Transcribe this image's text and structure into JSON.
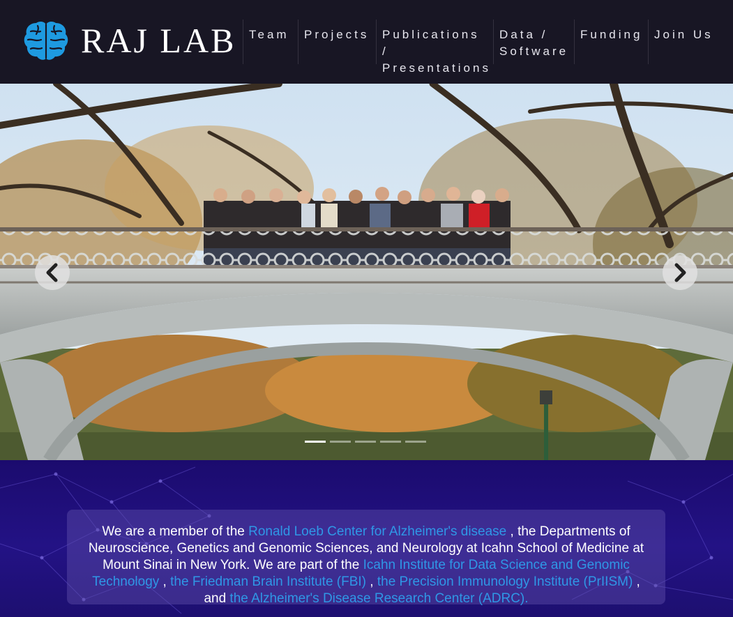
{
  "header": {
    "logo_icon": "brain-icon",
    "logo_text": "RAJ LAB",
    "accent_color": "#1e9ae0"
  },
  "nav": {
    "items": [
      {
        "label": "Team"
      },
      {
        "label": "Projects"
      },
      {
        "label": "Publications /\nPresentations"
      },
      {
        "label": "Data /\nSoftware"
      },
      {
        "label": "Funding"
      },
      {
        "label": "Join Us"
      }
    ]
  },
  "carousel": {
    "prev_icon": "chevron-left-icon",
    "next_icon": "chevron-right-icon",
    "slide_count": 5,
    "active_slide": 1
  },
  "about": {
    "t1": "We are a member of the ",
    "link1": "Ronald Loeb Center for Alzheimer's disease",
    "t2": " , the Departments of Neuroscience, Genetics and Genomic Sciences, and Neurology at Icahn School of Medicine at Mount Sinai in New York. We are part of the ",
    "link2": "Icahn Institute for Data Science and Genomic Technology",
    "t3": " , ",
    "link3": "the Friedman Brain Institute (FBI)",
    "t4": " , ",
    "link4": "the Precision Immunology Institute (PrIISM)",
    "t5": " , and ",
    "link5": "the Alzheimer's Disease Research Center (ADRC).",
    "link_color": "#2f97e6"
  }
}
